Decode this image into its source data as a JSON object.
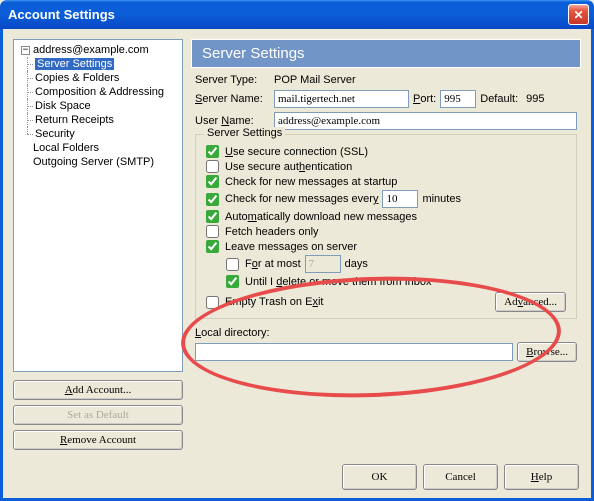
{
  "window": {
    "title": "Account Settings"
  },
  "tree": {
    "account": "address@example.com",
    "items": [
      "Server Settings",
      "Copies & Folders",
      "Composition & Addressing",
      "Disk Space",
      "Return Receipts",
      "Security"
    ],
    "local_folders": "Local Folders",
    "outgoing": "Outgoing Server (SMTP)"
  },
  "left_buttons": {
    "add": "Add Account...",
    "default": "Set as Default",
    "remove": "Remove Account"
  },
  "panel": {
    "title": "Server Settings",
    "server_type_label": "Server Type:",
    "server_type": "POP Mail Server",
    "server_name_label": "Server Name:",
    "server_name": "mail.tigertech.net",
    "port_label": "Port:",
    "port": "995",
    "default_label": "Default:",
    "default_port": "995",
    "user_name_label": "User Name:",
    "user_name": "address@example.com"
  },
  "settings": {
    "legend": "Server Settings",
    "ssl": "Use secure connection (SSL)",
    "auth": "Use secure authentication",
    "startup": "Check for new messages at startup",
    "check_every": "Check for new messages every",
    "check_mins": "10",
    "minutes": "minutes",
    "auto_dl": "Automatically download new messages",
    "fetch_headers": "Fetch headers only",
    "leave_msgs": "Leave messages on server",
    "for_at_most": "For at most",
    "for_days": "7",
    "days": "days",
    "until_delete": "Until I delete or move them from Inbox",
    "empty_trash": "Empty Trash on Exit",
    "advanced": "Advanced..."
  },
  "local_dir": {
    "label": "Local directory:",
    "value": "",
    "browse": "Browse..."
  },
  "footer": {
    "ok": "OK",
    "cancel": "Cancel",
    "help": "Help"
  }
}
